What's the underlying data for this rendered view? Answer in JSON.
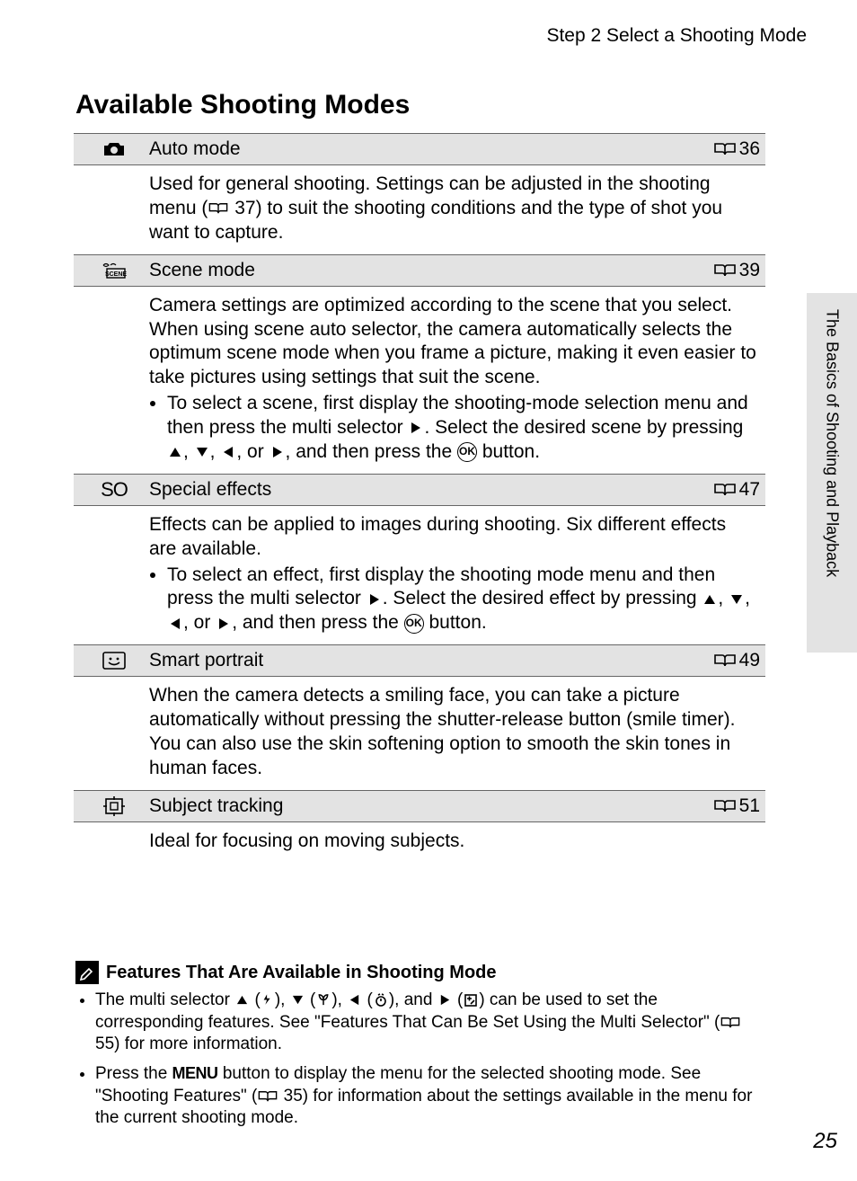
{
  "breadcrumb": "Step 2 Select a Shooting Mode",
  "heading": "Available Shooting Modes",
  "side_tab": "The Basics of Shooting and Playback",
  "page_number": "25",
  "modes": {
    "auto": {
      "title": "Auto mode",
      "page": "36",
      "desc": "Used for general shooting. Settings can be adjusted in the shooting menu (",
      "desc_ref": "37",
      "desc_tail": ") to suit the shooting conditions and the type of shot you want to capture."
    },
    "scene": {
      "title": "Scene mode",
      "page": "39",
      "desc": "Camera settings are optimized according to the scene that you select. When using scene auto selector, the camera automatically selects the optimum scene mode when you frame a picture, making it even easier to take pictures using settings that suit the scene.",
      "bullet_lead": "To select a scene, first display the shooting-mode selection menu and then press the multi selector ",
      "bullet_mid": ". Select the desired scene by pressing ",
      "bullet_tail": ", and then press the ",
      "bullet_end": " button.",
      "or": ", or "
    },
    "special": {
      "icon_text": "SO",
      "title": "Special effects",
      "page": "47",
      "desc": "Effects can be applied to images during shooting. Six different effects are available.",
      "bullet_lead": "To select an effect, first display the shooting mode menu and then press the multi selector ",
      "bullet_mid": ". Select the desired effect by pressing ",
      "bullet_tail": ", and then press the ",
      "bullet_end": " button.",
      "or": ", or "
    },
    "portrait": {
      "title": "Smart portrait",
      "page": "49",
      "desc": "When the camera detects a smiling face, you can take a picture automatically without pressing the shutter-release button (smile timer). You can also use the skin softening option to smooth the skin tones in human faces."
    },
    "tracking": {
      "title": "Subject tracking",
      "page": "51",
      "desc": "Ideal for focusing on moving subjects."
    }
  },
  "features": {
    "title": "Features That Are Available in Shooting Mode",
    "b1_lead": "The multi selector ",
    "b1_mid": " can be used to set the corresponding features. See \"Features That Can Be Set Using the Multi Selector\" (",
    "b1_ref": "55",
    "b1_tail": ") for more information.",
    "b1_and": ", and ",
    "b2_lead": "Press the ",
    "b2_menu": "MENU",
    "b2_mid": " button to display the menu for the selected shooting mode. See \"Shooting Features\" (",
    "b2_ref": "35",
    "b2_tail": ") for information about the settings available in the menu for the current shooting mode."
  },
  "ok_label": "OK"
}
